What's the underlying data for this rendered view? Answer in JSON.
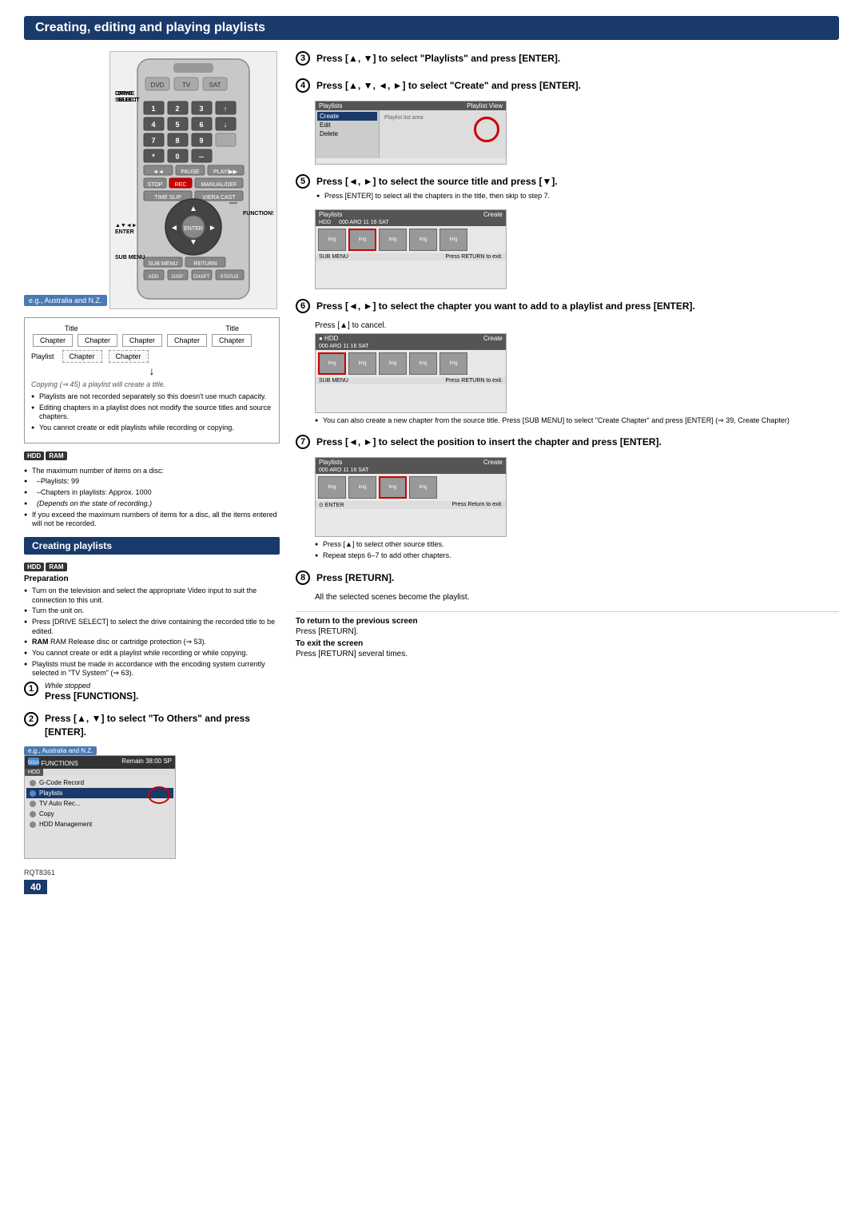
{
  "page": {
    "title": "Creating, editing and playing playlists",
    "section1": "Creating playlists",
    "rqt_number": "RQT8361",
    "page_number": "40"
  },
  "remote": {
    "eg_label": "e.g., Australia and N.Z.",
    "labels": {
      "drive_select": "DRIVE SELECT",
      "enter": "ENTER",
      "sub_menu": "SUB MENU",
      "functions": "FUNCTIONS",
      "return": "RETURN",
      "arrow": "▲▼◄►"
    },
    "numpad": [
      "1",
      "2",
      "3",
      "4",
      "5",
      "6",
      "7",
      "8",
      "9",
      "*",
      "0",
      "--"
    ]
  },
  "diagram": {
    "title_label1": "Title",
    "title_label2": "Title",
    "chapters": [
      "Chapter",
      "Chapter",
      "Chapter",
      "Chapter",
      "Chapter"
    ],
    "playlist_label": "Playlist",
    "playlist_chapters": [
      "Chapter",
      "Chapter"
    ],
    "copy_note": "Copying (⇒ 45) a playlist will create a title.",
    "bullets": [
      "Playlists are not recorded separately so this doesn't use much capacity.",
      "Editing chapters in a playlist does not modify the source titles and source chapters.",
      "You cannot create or edit playlists while recording or copying."
    ]
  },
  "hdd_ram_info": {
    "badge1": "HDD",
    "badge2": "RAM",
    "items": [
      "The maximum number of items on a disc:",
      "–Playlists:    99",
      "–Chapters in playlists:  Approx. 1000",
      "(Depends on the state of recording.)",
      "If you exceed the maximum numbers of items for a disc, all the items entered will not be recorded."
    ]
  },
  "preparation": {
    "hdd_label": "HDD",
    "ram_label": "RAM",
    "prep_label": "Preparation",
    "bullets": [
      "Turn on the television and select the appropriate Video input to suit the connection to this unit.",
      "Turn the unit on.",
      "Press [DRIVE SELECT] to select the drive containing the recorded title to be edited.",
      "RAM Release disc or cartridge protection (⇒ 53).",
      "You cannot create or edit a playlist while recording or while copying.",
      "Playlists must be made in accordance with the encoding system currently selected in \"TV System\" (⇒ 63)."
    ]
  },
  "steps_left": {
    "step1": {
      "number": "1",
      "sub": "While stopped",
      "title": "Press [FUNCTIONS]."
    },
    "step2": {
      "number": "2",
      "title": "Press [▲, ▼] to select \"To Others\" and press [ENTER].",
      "eg_label": "e.g., Australia and N.Z."
    }
  },
  "steps_right": {
    "step3": {
      "number": "3",
      "title": "Press [▲, ▼] to select \"Playlists\" and press [ENTER]."
    },
    "step4": {
      "number": "4",
      "title": "Press [▲, ▼, ◄, ►] to select \"Create\" and press [ENTER]."
    },
    "step5": {
      "number": "5",
      "title": "Press [◄, ►] to select the source title and press [▼].",
      "note": "Press [ENTER] to select all the chapters in the title, then skip to step 7."
    },
    "step6": {
      "number": "6",
      "title": "Press [◄, ►] to select the chapter you want to add to a playlist and press [ENTER].",
      "note1": "Press [▲] to cancel.",
      "note2": "You can also create a new chapter from the source title. Press [SUB MENU] to select \"Create Chapter\" and press [ENTER] (⇒ 39, Create Chapter)"
    },
    "step7": {
      "number": "7",
      "title": "Press [◄, ►] to select the position to insert the chapter and press [ENTER]."
    },
    "step8": {
      "number": "8",
      "title": "Press [RETURN].",
      "note": "All the selected scenes become the playlist."
    }
  },
  "return_info": {
    "label1": "To return to the previous screen",
    "text1": "Press [RETURN].",
    "label2": "To exit the screen",
    "text2": "Press [RETURN] several times."
  },
  "functions_screen": {
    "header_left": "HDD",
    "header_right": "Remain  38:00 SP",
    "menu_items": [
      {
        "label": "G-Code Record",
        "active": false
      },
      {
        "label": "Playlists",
        "active": true
      },
      {
        "label": "TV Auto Rec...",
        "active": false
      },
      {
        "label": "Copy",
        "active": false
      },
      {
        "label": "HDD Management",
        "active": false
      }
    ]
  }
}
